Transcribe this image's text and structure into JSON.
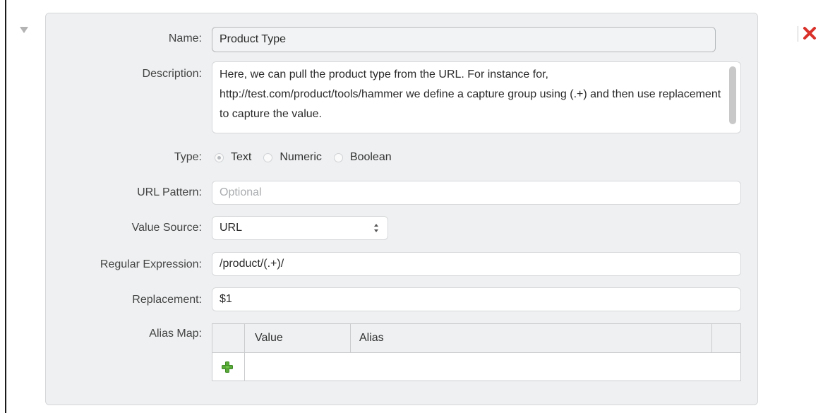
{
  "form": {
    "name": {
      "label": "Name:",
      "value": "Product Type"
    },
    "description": {
      "label": "Description:",
      "value": "Here, we can pull the product type from the URL. For instance for, http://test.com/product/tools/hammer we define a capture group using (.+) and then use replacement to capture the value."
    },
    "type": {
      "label": "Type:",
      "options": [
        "Text",
        "Numeric",
        "Boolean"
      ],
      "selected": "Text"
    },
    "url_pattern": {
      "label": "URL Pattern:",
      "value": "",
      "placeholder": "Optional"
    },
    "value_source": {
      "label": "Value Source:",
      "selected": "URL"
    },
    "regular_expression": {
      "label": "Regular Expression:",
      "value": "/product/(.+)/"
    },
    "replacement": {
      "label": "Replacement:",
      "value": "$1"
    },
    "alias_map": {
      "label": "Alias Map:",
      "columns": [
        "Value",
        "Alias"
      ],
      "rows": []
    }
  },
  "icons": {
    "collapse": "triangle-down-icon",
    "delete": "red-x-icon",
    "add_row": "green-plus-icon",
    "select": "up-down-arrows-icon"
  },
  "colors": {
    "delete": "#d9302a",
    "add": "#5aaa3a"
  }
}
